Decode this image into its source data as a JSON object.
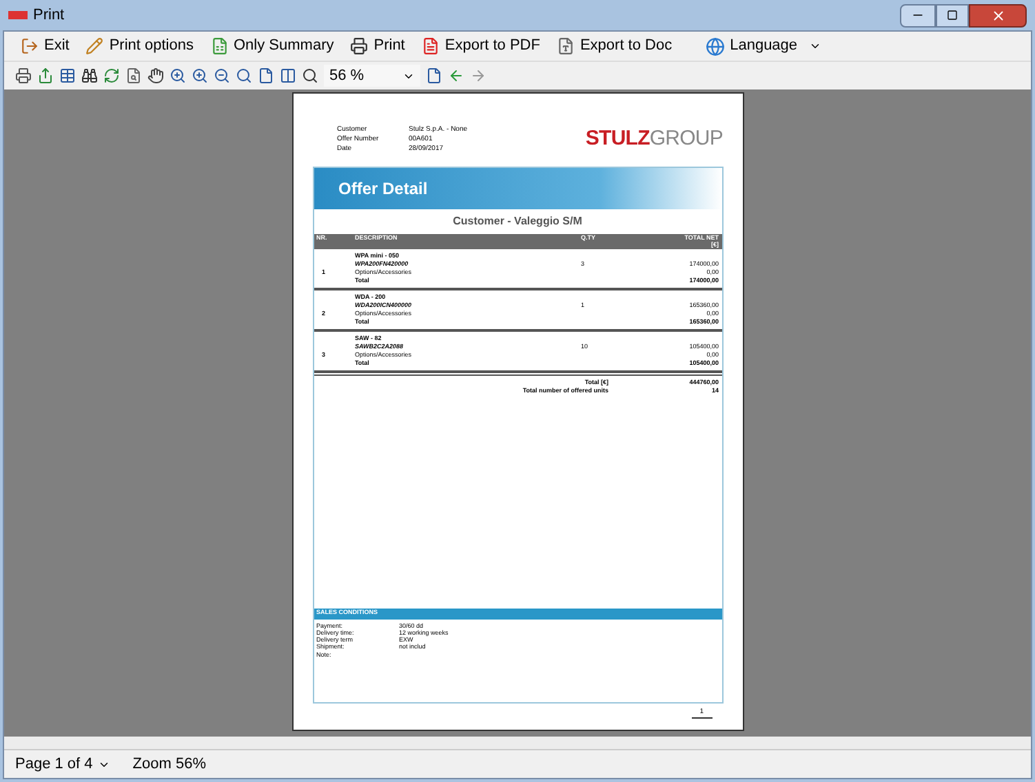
{
  "window": {
    "title": "Print"
  },
  "toolbar": [
    {
      "kind": "button",
      "label": "Exit"
    },
    {
      "kind": "button",
      "label": "Print options"
    },
    {
      "kind": "button",
      "label": "Only Summary"
    },
    {
      "kind": "button",
      "label": "Print"
    },
    {
      "kind": "button",
      "label": "Export to PDF"
    },
    {
      "kind": "button",
      "label": "Export to Doc"
    },
    {
      "kind": "dropdown",
      "label": "Language"
    }
  ],
  "zoom_field": {
    "value": "56 %"
  },
  "document": {
    "header": [
      {
        "label": "Customer",
        "value": "Stulz S.p.A. - None"
      },
      {
        "label": "Offer Number",
        "value": "00A601"
      },
      {
        "label": "Date",
        "value": "28/09/2017"
      }
    ],
    "logo": {
      "bold": "STULZ",
      "light": "GROUP"
    },
    "banner": "Offer Detail",
    "subtitle": "Customer - Valeggio S/M",
    "columns": [
      "NR.",
      "DESCRIPTION",
      "Q.TY",
      "TOTAL NET",
      "[€]"
    ],
    "items": [
      {
        "nr": "1",
        "name": "WPA mini - 050",
        "code": "WPA200FN420000",
        "qty": "3",
        "price": "174000,00",
        "options_label": "Options/Accessories",
        "options": "0,00",
        "total_label": "Total",
        "total": "174000,00"
      },
      {
        "nr": "2",
        "name": "WDA - 200",
        "code": "WDA200ICN400000",
        "qty": "1",
        "price": "165360,00",
        "options_label": "Options/Accessories",
        "options": "0,00",
        "total_label": "Total",
        "total": "165360,00"
      },
      {
        "nr": "3",
        "name": "SAW - 82",
        "code": "SAWB2C2A2088",
        "qty": "10",
        "price": "105400,00",
        "options_label": "Options/Accessories",
        "options": "0,00",
        "total_label": "Total",
        "total": "105400,00"
      }
    ],
    "totals": [
      {
        "label": "Total [€]",
        "value": "444760,00"
      },
      {
        "label": "Total number of offered units",
        "value": "14"
      }
    ],
    "sales_title": "SALES CONDITIONS",
    "conditions": [
      {
        "label": "Payment:",
        "value": "30/60 dd"
      },
      {
        "label": "Delivery time:",
        "value": "12 working weeks"
      },
      {
        "label": "Delivery term",
        "value": "EXW"
      },
      {
        "label": "Shipment:",
        "value": "not includ"
      }
    ],
    "note_label": "Note:",
    "page_number": "1"
  },
  "status_bar": {
    "page": "Page 1 of 4",
    "zoom": "Zoom 56%"
  }
}
